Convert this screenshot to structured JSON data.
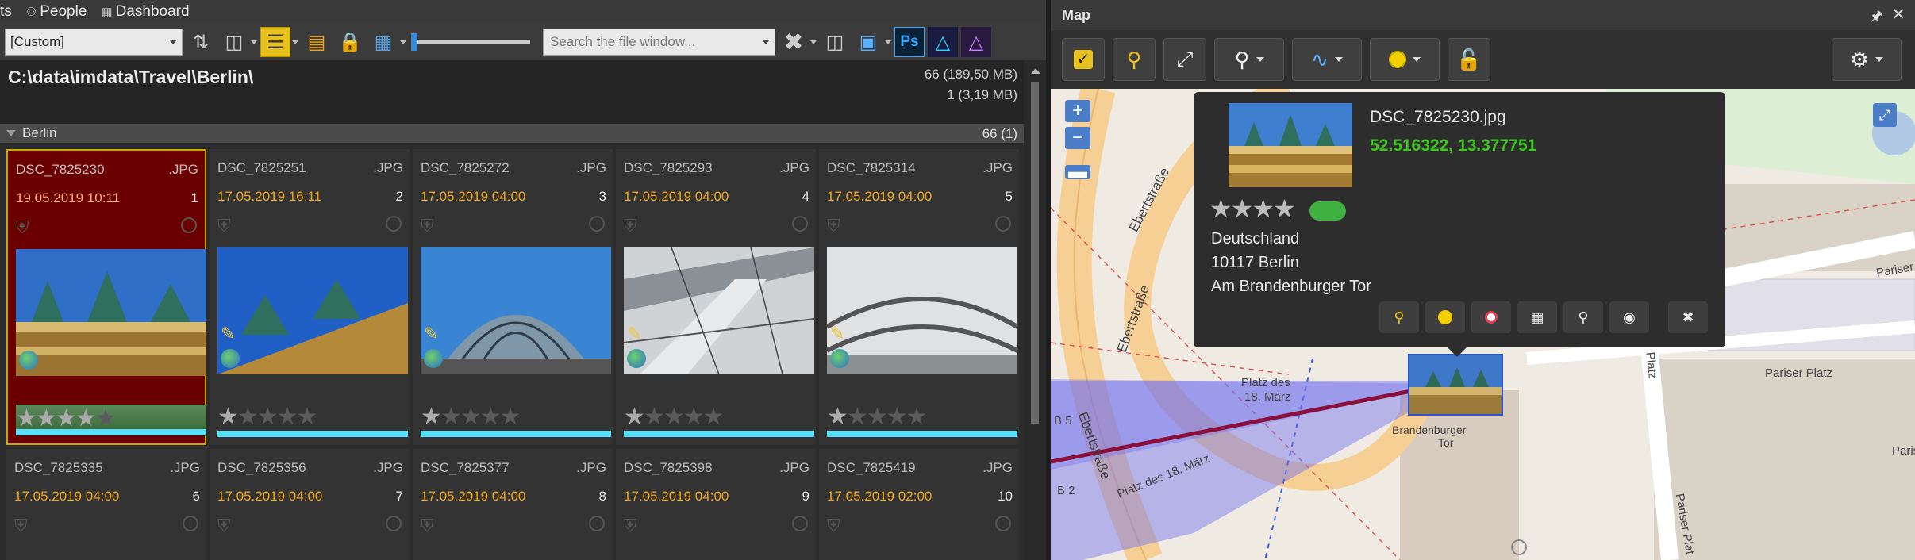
{
  "menu": {
    "items": [
      {
        "label": "ts",
        "icon": ""
      },
      {
        "label": "People",
        "icon": "people-icon"
      },
      {
        "label": "Dashboard",
        "icon": "dashboard-icon"
      }
    ]
  },
  "toolbar": {
    "view_combo": "[Custom]",
    "search_placeholder": "Search the file window...",
    "ps_label": "Ps"
  },
  "path": {
    "text": "C:\\data\\imdata\\Travel\\Berlin\\",
    "count_total": "66 (189,50 MB)",
    "count_selected": "1 (3,19 MB)"
  },
  "group": {
    "name": "Berlin",
    "count": "66 (1)"
  },
  "files": [
    {
      "name": "DSC_7825230",
      "ext": ".JPG",
      "date": "19.05.2019 10:11",
      "num": "1",
      "rating": 4,
      "selected": true,
      "thumb": "quadriga"
    },
    {
      "name": "DSC_7825251",
      "ext": ".JPG",
      "date": "17.05.2019 16:11",
      "num": "2",
      "rating": 1,
      "selected": false,
      "thumb": "quadriga2"
    },
    {
      "name": "DSC_7825272",
      "ext": ".JPG",
      "date": "17.05.2019 04:00",
      "num": "3",
      "rating": 1,
      "selected": false,
      "thumb": "dome"
    },
    {
      "name": "DSC_7825293",
      "ext": ".JPG",
      "date": "17.05.2019 04:00",
      "num": "4",
      "rating": 1,
      "selected": false,
      "thumb": "ramp"
    },
    {
      "name": "DSC_7825314",
      "ext": ".JPG",
      "date": "17.05.2019 04:00",
      "num": "5",
      "rating": 1,
      "selected": false,
      "thumb": "interior"
    },
    {
      "name": "DSC_7825335",
      "ext": ".JPG",
      "date": "17.05.2019 04:00",
      "num": "6"
    },
    {
      "name": "DSC_7825356",
      "ext": ".JPG",
      "date": "17.05.2019 04:00",
      "num": "7"
    },
    {
      "name": "DSC_7825377",
      "ext": ".JPG",
      "date": "17.05.2019 04:00",
      "num": "8"
    },
    {
      "name": "DSC_7825398",
      "ext": ".JPG",
      "date": "17.05.2019 04:00",
      "num": "9"
    },
    {
      "name": "DSC_7825419",
      "ext": ".JPG",
      "date": "17.05.2019 02:00",
      "num": "10"
    }
  ],
  "map": {
    "title": "Map",
    "popup": {
      "filename": "DSC_7825230.jpg",
      "coords": "52.516322, 13.377751",
      "rating": 4,
      "country": "Deutschland",
      "city": "10117 Berlin",
      "street": "Am Brandenburger Tor"
    },
    "labels": {
      "ebert1": "Ebertstraße",
      "ebert2": "Ebertstraße",
      "ebert3": "Ebertstraße",
      "platz1a": "Platz des",
      "platz1b": "18. März",
      "platz2": "Platz des 18. März",
      "bt1": "Brandenburger",
      "bt2": "Tor",
      "pariser1": "Pariser",
      "pariser2": "Pariser Platz",
      "pariser3": "Pariser Plat",
      "pari": "Paris",
      "platz3": "Platz",
      "b5": "B 5",
      "b2": "B 2"
    }
  },
  "colors": {
    "accent": "#e7c21e",
    "selected_bg": "#6b0000",
    "date": "#f0a51c",
    "coords": "#3cc61e",
    "cyan_bar": "#5ae0ff"
  }
}
